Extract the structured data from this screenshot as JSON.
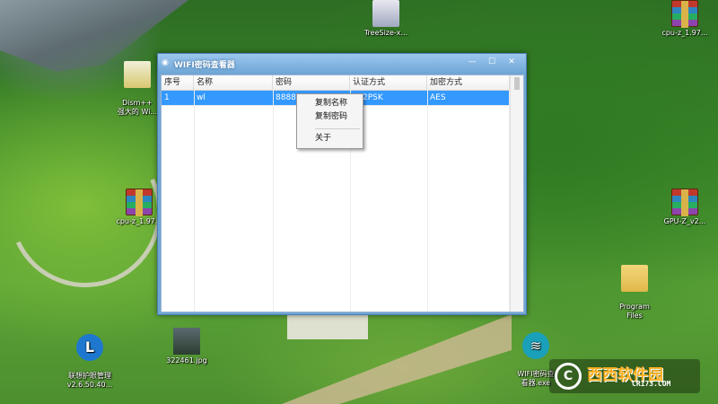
{
  "desktop": {
    "icons": [
      {
        "id": "treesize",
        "label": "TreeSize-x...",
        "icon": "treesize-app-icon"
      },
      {
        "id": "cpu-z-top",
        "label": "cpu-z_1.97...",
        "icon": "winrar-archive-icon"
      },
      {
        "id": "dism",
        "label": "Dism++\n强大的 Wi...",
        "icon": "dism-app-icon"
      },
      {
        "id": "cpu-z-mid",
        "label": "cpu-z_1.97...",
        "icon": "winrar-archive-icon"
      },
      {
        "id": "gpu-z",
        "label": "GPU-Z_v2...",
        "icon": "winrar-archive-icon"
      },
      {
        "id": "program-files",
        "label": "Program\nFiles",
        "icon": "folder-icon"
      },
      {
        "id": "lenovo",
        "label": "联想护眼管理\nv2.6.50.40...",
        "icon": "lenovo-l-icon"
      },
      {
        "id": "photo",
        "label": "322461.jpg",
        "icon": "image-file-icon"
      },
      {
        "id": "wifi-viewer",
        "label": "WIFI密码查\n看器.exe",
        "icon": "wifi-icon"
      }
    ],
    "watermark": {
      "logo": "C",
      "text": "西西软件园",
      "sub": "CR173.COM"
    }
  },
  "window": {
    "title": "WIFI密码查看器",
    "controls": {
      "minimize": "—",
      "maximize": "☐",
      "close": "✕"
    },
    "columns": [
      "序号",
      "名称",
      "密码",
      "认证方式",
      "加密方式"
    ],
    "rows": [
      {
        "index": "1",
        "name": "wl",
        "password": "8888",
        "auth": "PA2PSK",
        "encryption": "AES",
        "selected": true
      }
    ]
  },
  "context_menu": {
    "items": [
      "复制名称",
      "复制密码",
      "关于"
    ]
  }
}
